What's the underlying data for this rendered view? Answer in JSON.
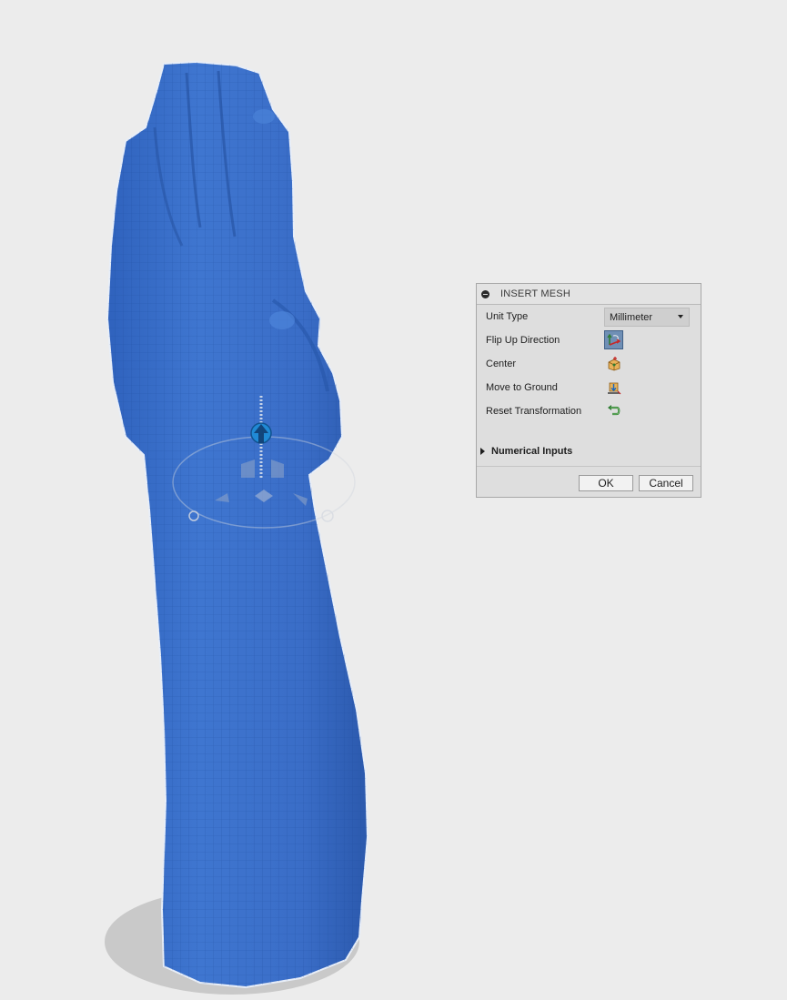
{
  "dialog": {
    "title": "INSERT MESH",
    "rows": [
      {
        "label": "Unit Type",
        "control": "select",
        "value": "Millimeter"
      },
      {
        "label": "Flip Up Direction",
        "control": "icon",
        "icon": "flip-axis-icon"
      },
      {
        "label": "Center",
        "control": "icon",
        "icon": "center-icon"
      },
      {
        "label": "Move to Ground",
        "control": "icon",
        "icon": "move-to-ground-icon"
      },
      {
        "label": "Reset Transformation",
        "control": "icon",
        "icon": "reset-icon"
      }
    ],
    "section": "Numerical Inputs",
    "ok_label": "OK",
    "cancel_label": "Cancel"
  },
  "viewport": {
    "mesh_color": "#3a6fc8",
    "background": "#ececec"
  }
}
